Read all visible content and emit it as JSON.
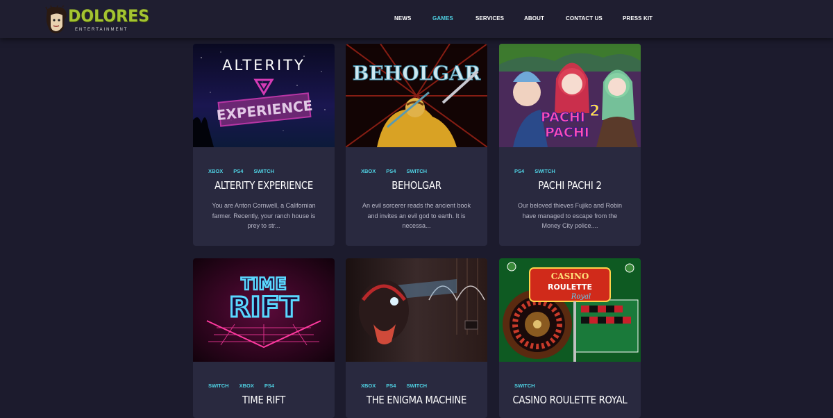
{
  "brand": {
    "name": "DOLORES",
    "subtitle": "ENTERTAINMENT"
  },
  "nav": {
    "items": [
      {
        "label": "NEWS",
        "active": false
      },
      {
        "label": "GAMES",
        "active": true
      },
      {
        "label": "SERVICES",
        "active": false
      },
      {
        "label": "ABOUT",
        "active": false
      },
      {
        "label": "CONTACT US",
        "active": false
      },
      {
        "label": "PRESS KIT",
        "active": false
      }
    ]
  },
  "colors": {
    "background": "#1c1b2d",
    "card": "#29293f",
    "accent": "#4fd0e2",
    "logo_green": "#a4c431"
  },
  "games": [
    {
      "title": "ALTERITY EXPERIENCE",
      "platforms": [
        "XBOX",
        "PS4",
        "SWITCH"
      ],
      "description_lines": [
        "You are Anton Cornwell, a Californian",
        "farmer. Recently, your ranch house is",
        "prey to str..."
      ],
      "art_text": [
        "ALTERITY",
        "EXPERIENCE"
      ]
    },
    {
      "title": "BEHOLGAR",
      "platforms": [
        "XBOX",
        "PS4",
        "SWITCH"
      ],
      "description_lines": [
        "An evil sorcerer reads the ancient book",
        "and invites an evil god to earth. It is",
        "necessa..."
      ],
      "art_text": [
        "BEHOLGAR"
      ]
    },
    {
      "title": "PACHI PACHI 2",
      "platforms": [
        "PS4",
        "SWITCH"
      ],
      "description_lines": [
        "Our beloved thieves Fujiko and Robin",
        "have managed to escape from the",
        "Money City police...."
      ],
      "art_text": [
        "PACHI",
        "PACHI",
        "2"
      ]
    },
    {
      "title": "TIME RIFT",
      "platforms": [
        "SWITCH",
        "XBOX",
        "PS4"
      ],
      "description_lines": [],
      "art_text": [
        "TIME",
        "RIFT"
      ]
    },
    {
      "title": "THE ENIGMA MACHINE",
      "platforms": [
        "XBOX",
        "PS4",
        "SWITCH"
      ],
      "description_lines": [],
      "art_text": []
    },
    {
      "title": "CASINO ROULETTE ROYAL",
      "platforms": [
        "SWITCH"
      ],
      "description_lines": [],
      "art_text": [
        "CASINO",
        "ROULETTE",
        "Royal"
      ]
    }
  ]
}
